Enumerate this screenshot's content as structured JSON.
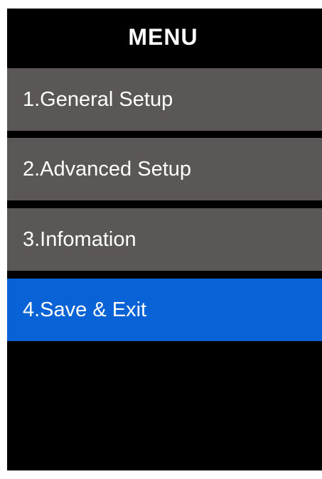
{
  "menu": {
    "title": "MENU",
    "items": [
      {
        "label": "1.General Setup",
        "selected": false
      },
      {
        "label": "2.Advanced Setup",
        "selected": false
      },
      {
        "label": "3.Infomation",
        "selected": false
      },
      {
        "label": "4.Save & Exit",
        "selected": true
      }
    ]
  },
  "colors": {
    "background": "#000000",
    "item_normal": "#5b5756",
    "item_selected": "#0a63d6",
    "text": "#ffffff"
  }
}
